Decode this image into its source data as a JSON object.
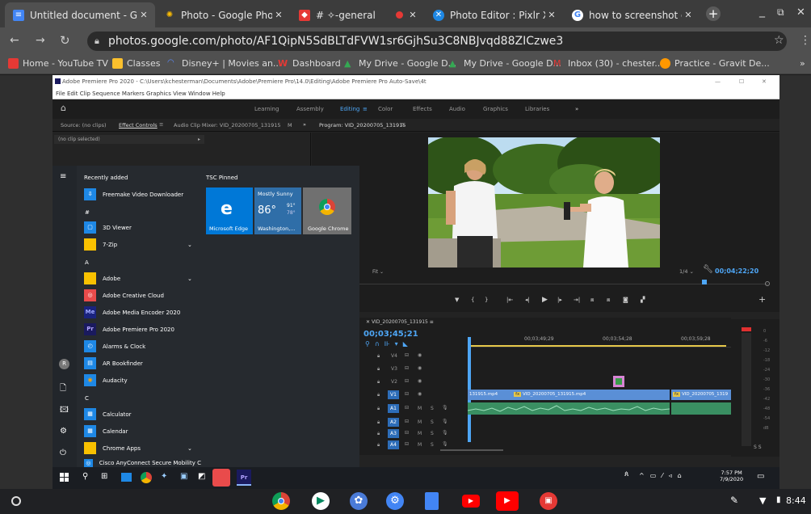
{
  "browser": {
    "tabs": [
      {
        "title": "Untitled document - Goog",
        "icon_color": "#4285f4"
      },
      {
        "title": "Photo - Google Photos",
        "icon_color": "#fbbc04"
      },
      {
        "title": "# ✧-general",
        "icon_color": "#e53935"
      },
      {
        "title": "Photo Editor : Pixlr X - free",
        "icon_color": "#1e88e5"
      },
      {
        "title": "how to screenshot on ch",
        "icon_color": "#ffffff"
      }
    ],
    "new_tab": "+",
    "url": "photos.google.com/photo/AF1QipN5SdBLTdFVW1sr6GjhSu3C8NBJvqd88ZICzwe3",
    "bookmarks": [
      {
        "label": "Home - YouTube TV",
        "color": "#e53935"
      },
      {
        "label": "Classes",
        "color": "#fbc02d"
      },
      {
        "label": "Disney+ | Movies an...",
        "color": "#1e3c96"
      },
      {
        "label": "Dashboard",
        "color": "#e53935"
      },
      {
        "label": "My Drive - Google D...",
        "color": "#34a853"
      },
      {
        "label": "My Drive - Google D...",
        "color": "#34a853"
      },
      {
        "label": "Inbox (30) - chester...",
        "color": "#e53935"
      },
      {
        "label": "Practice - Gravit De...",
        "color": "#ff9800"
      }
    ],
    "more": "»"
  },
  "premiere": {
    "title": "Adobe Premiere Pro 2020 - C:\\Users\\kchesterman\\Documents\\Adobe\\Premiere Pro\\14.0\\Editing\\Adobe Premiere Pro Auto-Save\\4t",
    "menu": "File  Edit  Clip  Sequence  Markers  Graphics  View  Window  Help",
    "workspaces": [
      "Learning",
      "Assembly",
      "Editing",
      "Color",
      "Effects",
      "Audio",
      "Graphics",
      "Libraries"
    ],
    "ws_more": "»",
    "panel_tabs": {
      "source": "Source: (no clips)",
      "effect_controls": "Effect Controls",
      "audio_mixer": "Audio Clip Mixer: VID_20200705_131915",
      "m": "M",
      "program": "Program: VID_20200705_131915"
    },
    "no_clip": "(no clip selected)",
    "fit": "Fit",
    "quality": "1/4",
    "program_tc": "00;04;22;20",
    "sequence_name": "VID_20200705_131915",
    "timeline_tc": "00;03;45;21",
    "ruler": [
      "00;03;49;29",
      "00;03;54;28",
      "00;03;59;28"
    ],
    "video_tracks": [
      "V4",
      "V3",
      "V2",
      "V1"
    ],
    "audio_tracks": [
      "A1",
      "A2",
      "A3",
      "A4"
    ],
    "clip_labels": [
      "131915.mp4",
      "VID_20200705_131915.mp4",
      "VID_20200705_1319"
    ],
    "meter_scale": [
      "0",
      "-6",
      "-12",
      "-18",
      "-24",
      "-30",
      "-36",
      "-42",
      "-48",
      "-54",
      "dB"
    ],
    "meter_ss": "S  S"
  },
  "start_menu": {
    "recent_header": "Recently added",
    "pinned_header": "TSC Pinned",
    "recent": [
      {
        "label": "Freemake Video Downloader",
        "icon_color": "#1e88e5",
        "icon": "⇩"
      }
    ],
    "sections": [
      {
        "letter": "#",
        "apps": [
          {
            "label": "3D Viewer",
            "icon_color": "#1e88e5",
            "icon": "▢"
          },
          {
            "label": "7-Zip",
            "icon_color": "#f9c100",
            "icon": "",
            "expand": true
          }
        ]
      },
      {
        "letter": "A",
        "apps": [
          {
            "label": "Adobe",
            "icon_color": "#f9c100",
            "icon": "",
            "expand": true
          },
          {
            "label": "Adobe Creative Cloud",
            "icon_color": "#e94b4b",
            "icon": "◎"
          },
          {
            "label": "Adobe Media Encoder 2020",
            "icon_color": "#1a237e",
            "icon": "Me"
          },
          {
            "label": "Adobe Premiere Pro 2020",
            "icon_color": "#1a1a5e",
            "icon": "Pr"
          },
          {
            "label": "Alarms & Clock",
            "icon_color": "#1e88e5",
            "icon": "◴"
          },
          {
            "label": "AR Bookfinder",
            "icon_color": "#1e88e5",
            "icon": "▤"
          },
          {
            "label": "Audacity",
            "icon_color": "#1e88e5",
            "icon": "◉"
          }
        ]
      },
      {
        "letter": "C",
        "apps": [
          {
            "label": "Calculator",
            "icon_color": "#1e88e5",
            "icon": "▦"
          },
          {
            "label": "Calendar",
            "icon_color": "#1e88e5",
            "icon": "▦"
          },
          {
            "label": "Chrome Apps",
            "icon_color": "#f9c100",
            "icon": "",
            "expand": true
          },
          {
            "label": "Cisco AnyConnect Secure Mobility C",
            "icon_color": "#1e88e5",
            "icon": "◎"
          }
        ]
      }
    ],
    "tiles": {
      "edge": "Microsoft Edge",
      "weather_title": "Mostly Sunny",
      "weather_temp": "86°",
      "weather_hi": "91°",
      "weather_lo": "78°",
      "weather_city": "Washington,...",
      "chrome": "Google Chrome"
    }
  },
  "taskbar": {
    "time": "7:57 PM",
    "date": "7/9/2020"
  },
  "chromeos": {
    "time": "8:44"
  },
  "colors": {
    "accent_blue": "#1a73e8",
    "premiere_blue": "#2d8ceb",
    "win_blue": "#0078d7"
  }
}
